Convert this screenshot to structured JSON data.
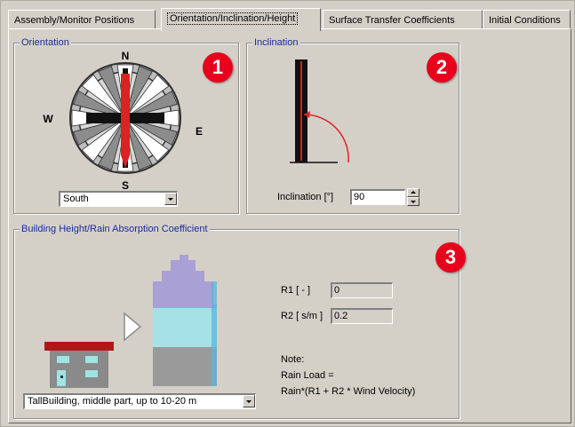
{
  "tabs": [
    {
      "label": "Assembly/Monitor Positions"
    },
    {
      "label": "Orientation/Inclination/Height"
    },
    {
      "label": "Surface Transfer Coefficients"
    },
    {
      "label": "Initial Conditions"
    }
  ],
  "orientation": {
    "title": "Orientation",
    "marker": "1",
    "compass": {
      "n": "N",
      "s": "S",
      "e": "E",
      "w": "W"
    },
    "selected": "South"
  },
  "inclination": {
    "title": "Inclination",
    "marker": "2",
    "label": "Inclination [°]",
    "value": "90"
  },
  "height": {
    "title": "Building Height/Rain Absorption Coefficient",
    "marker": "3",
    "r1_label": "R1 [ - ]",
    "r1_value": "0",
    "r2_label": "R2 [ s/m ]",
    "r2_value": "0.2",
    "note_lines": [
      "Note:",
      "Rain Load =",
      "Rain*(R1 + R2 * Wind Velocity)"
    ],
    "selected": "TallBuilding, middle part, up to 10-20 m"
  },
  "colors": {
    "accent_red": "#e8001c",
    "group_label": "#1c2c9c",
    "panel": "#d4d0c8"
  }
}
